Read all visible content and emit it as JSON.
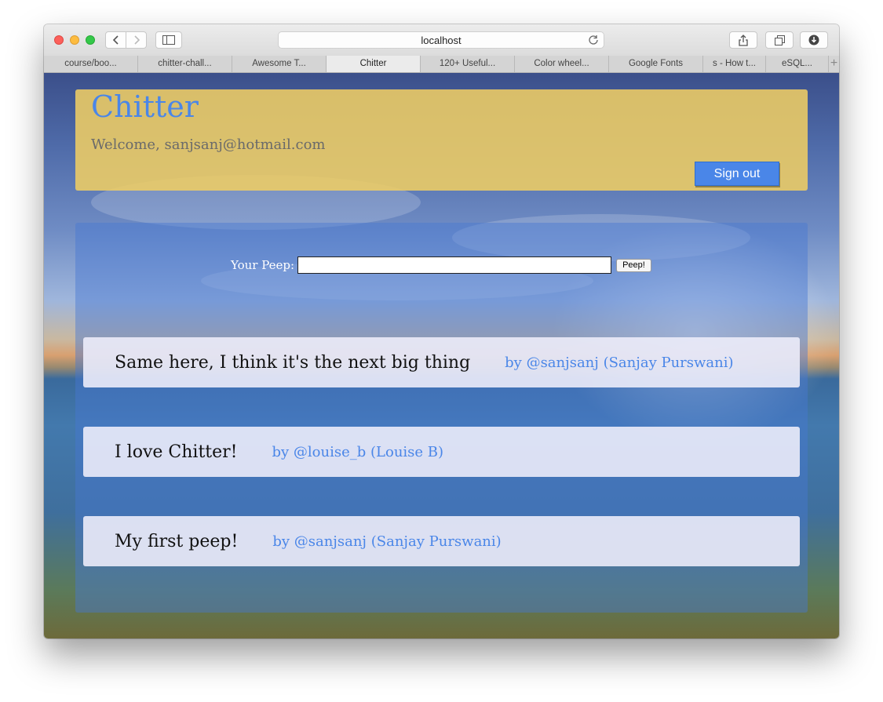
{
  "browser": {
    "url": "localhost",
    "tabs": [
      {
        "label": "course/boo..."
      },
      {
        "label": "chitter-chall..."
      },
      {
        "label": "Awesome T..."
      },
      {
        "label": "Chitter"
      },
      {
        "label": "120+ Useful..."
      },
      {
        "label": "Color wheel..."
      },
      {
        "label": "Google Fonts"
      },
      {
        "label": "s - How t..."
      },
      {
        "label": "eSQL..."
      }
    ],
    "active_tab": "Chitter"
  },
  "header": {
    "title": "Chitter",
    "welcome": "Welcome, sanjsanj@hotmail.com",
    "signout_label": "Sign out"
  },
  "peep_form": {
    "label": "Your Peep:",
    "input_value": "",
    "button_label": "Peep!"
  },
  "peeps": [
    {
      "text": "Same here, I think it's the next big thing",
      "author": "by @sanjsanj (Sanjay Purswani)"
    },
    {
      "text": "I love Chitter!",
      "author": "by @louise_b (Louise B)"
    },
    {
      "text": "My first peep!",
      "author": "by @sanjsanj (Sanjay Purswani)"
    }
  ],
  "colors": {
    "accent": "#4a86e8",
    "header_bg": "#eecd64"
  }
}
